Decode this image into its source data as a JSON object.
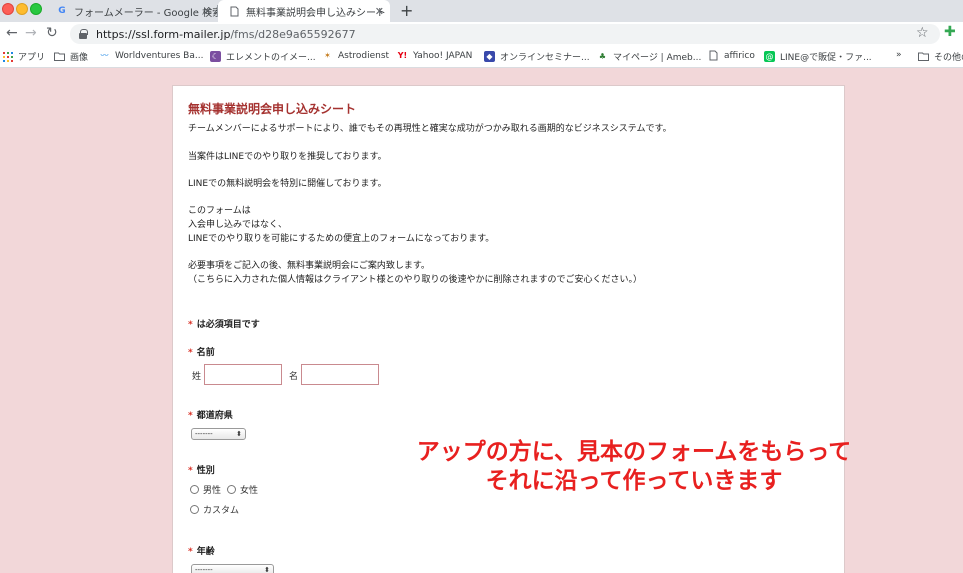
{
  "browser": {
    "tabs": [
      {
        "title": "フォームメーラー - Google 検索",
        "favicon": "google-favicon"
      },
      {
        "title": "無料事業説明会申し込みシート",
        "favicon": "page-favicon"
      }
    ],
    "url_host": "https://ssl.form-mailer.jp",
    "url_path": "/fms/d28e9a65592677",
    "bookmarks": [
      {
        "label": "アプリ",
        "icon": "apps-grid-icon"
      },
      {
        "label": "画像",
        "icon": "folder-icon"
      },
      {
        "label": "Worldventures Ba...",
        "icon": "wv-icon"
      },
      {
        "label": "エレメントのイメー...",
        "icon": "moon-icon"
      },
      {
        "label": "Astrodienst",
        "icon": "astro-icon"
      },
      {
        "label": "Yahoo! JAPAN",
        "icon": "yahoo-icon"
      },
      {
        "label": "オンラインセミナー...",
        "icon": "seminar-icon"
      },
      {
        "label": "マイページ | Ameb...",
        "icon": "ameba-icon"
      },
      {
        "label": "affirico",
        "icon": "page-icon"
      },
      {
        "label": "LINE@で販促・ファ...",
        "icon": "line-icon"
      },
      {
        "label": "その他の",
        "icon": "folder-icon"
      }
    ],
    "more_bookmarks": "»"
  },
  "form": {
    "title": "無料事業説明会申し込みシート",
    "description": [
      "チームメンバーによるサポートにより、誰でもその再現性と確実な成功がつかみ取れる画期的なビジネスシステムです。",
      "当案件はLINEでのやり取りを推奨しております。",
      "LINEでの無料説明会を特別に開催しております。",
      "このフォームは",
      "入会申し込みではなく、",
      "LINEでのやり取りを可能にするための便宜上のフォームになっております。",
      "必要事項をご記入の後、無料事業説明会にご案内致します。",
      "（こちらに入力された個人情報はクライアント様とのやり取りの後速やかに削除されますのでご安心ください。）"
    ],
    "required_mark": "*",
    "required_note": "は必須項目です",
    "name_label": "名前",
    "sei_label": "姓",
    "mei_label": "名",
    "prefecture_label": "都道府県",
    "prefecture_selected": "-------",
    "gender_label": "性別",
    "gender_options": [
      "男性",
      "女性",
      "カスタム"
    ],
    "age_label": "年齢",
    "age_selected": "-------"
  },
  "overlay": {
    "line1": "アップの方に、見本のフォームをもらって",
    "line2": "それに沿って作っていきます",
    "color": "#e8201f"
  }
}
